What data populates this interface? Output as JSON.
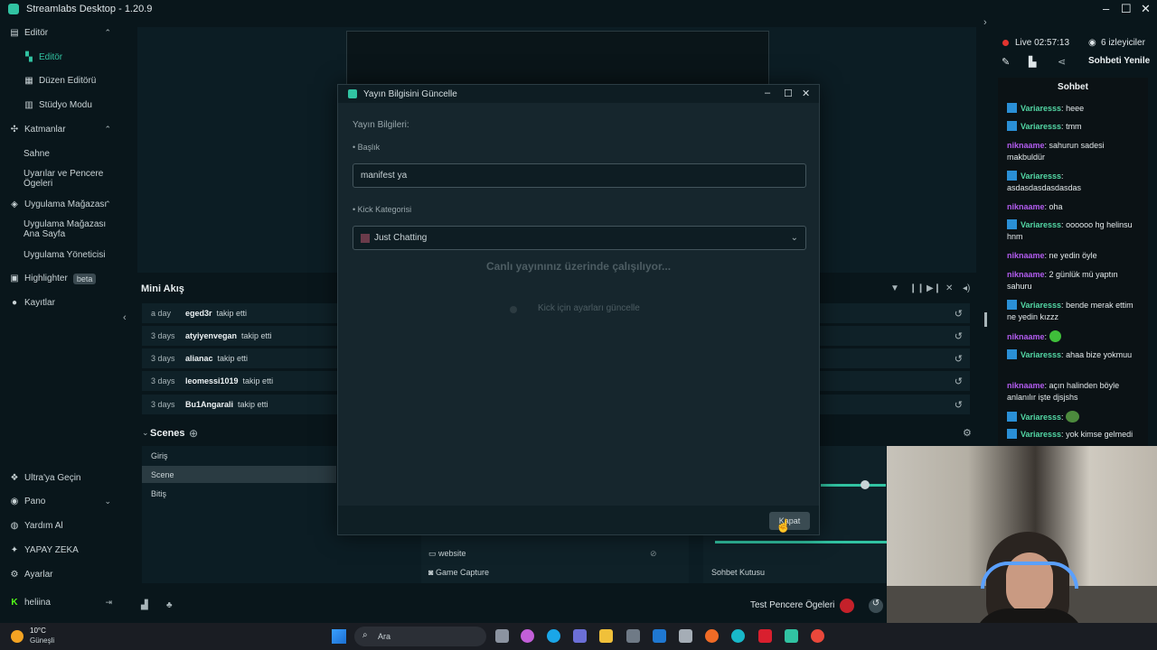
{
  "app": {
    "title": "Streamlabs Desktop - 1.20.9"
  },
  "sidebar": {
    "editor_group": "Editör",
    "editor": "Editör",
    "layout_editor": "Düzen Editörü",
    "studio_mode": "Stüdyo Modu",
    "layers_group": "Katmanlar",
    "scene": "Sahne",
    "alerts": "Uyarılar ve Pencere Ögeleri",
    "app_store_group": "Uygulama Mağazası",
    "app_store_home": "Uygulama Mağazası Ana Sayfa",
    "app_manager": "Uygulama Yöneticisi",
    "highlighter": "Highlighter",
    "beta": "beta",
    "recordings": "Kayıtlar",
    "ultra": "Ultra'ya Geçin",
    "dashboard": "Pano",
    "help": "Yardım Al",
    "ai": "YAPAY ZEKA",
    "settings": "Ayarlar",
    "user": "heliina"
  },
  "mini_feed": {
    "title": "Mini Akış",
    "rows": [
      {
        "age": "a day",
        "user": "eged3r",
        "action": "takip etti"
      },
      {
        "age": "3 days",
        "user": "atyiyenvegan",
        "action": "takip etti"
      },
      {
        "age": "3 days",
        "user": "alianac",
        "action": "takip etti"
      },
      {
        "age": "3 days",
        "user": "leomessi1019",
        "action": "takip etti"
      },
      {
        "age": "3 days",
        "user": "Bu1Angarali",
        "action": "takip etti"
      }
    ]
  },
  "scenes": {
    "title": "Scenes",
    "items": [
      "Giriş",
      "Scene",
      "Bitiş"
    ]
  },
  "sources": {
    "items": [
      "website",
      "Game Capture"
    ]
  },
  "mixer": {
    "label": "Sohbet Kutusu"
  },
  "bottom_bar": {
    "test_widgets": "Test Pencere Ögeleri"
  },
  "dialog": {
    "title": "Yayın Bilgisini Güncelle",
    "section": "Yayın Bilgileri:",
    "title_label": "Başlık",
    "title_value": "manifest ya",
    "category_label": "Kick Kategorisi",
    "category_value": "Just Chatting",
    "working": "Canlı yayınınız üzerinde çalışılıyor...",
    "step": "Kick için ayarları güncelle",
    "close": "Kapat"
  },
  "live": {
    "status": "Live 02:57:13",
    "viewers": "6 izleyiciler",
    "refresh_chat": "Sohbeti Yenile"
  },
  "chat": {
    "title": "Sohbet",
    "messages": [
      {
        "user": "Variaresss",
        "text": "heee",
        "kind": "v"
      },
      {
        "user": "Variaresss",
        "text": "tmm",
        "kind": "v"
      },
      {
        "user": "niknaame",
        "text": "sahurun sadesi makbuldür",
        "kind": "k"
      },
      {
        "user": "Variaresss",
        "text": "asdasdasdasdasdas",
        "kind": "v"
      },
      {
        "user": "niknaame",
        "text": "oha",
        "kind": "k"
      },
      {
        "user": "Variaresss",
        "text": "oooooo hg helinsu hnm",
        "kind": "v"
      },
      {
        "user": "niknaame",
        "text": "ne yedin öyle",
        "kind": "k"
      },
      {
        "user": "niknaame",
        "text": "2 günlük mü yaptın sahuru",
        "kind": "k"
      },
      {
        "user": "Variaresss",
        "text": "bende merak ettim ne yedin kızzz",
        "kind": "v"
      },
      {
        "user": "niknaame",
        "text": "",
        "kind": "k"
      },
      {
        "user": "Variaresss",
        "text": "ahaa bize yokmuu",
        "kind": "v"
      },
      {
        "user": "niknaame",
        "text": "açın halinden böyle anlanılır işte djsjshs",
        "kind": "k"
      },
      {
        "user": "Variaresss",
        "text": "",
        "kind": "v"
      },
      {
        "user": "Variaresss",
        "text": "yok kimse gelmedi",
        "kind": "v"
      }
    ]
  },
  "taskbar": {
    "weather_temp": "10°C",
    "weather_desc": "Güneşli",
    "search": "Ara"
  },
  "colors": {
    "accent": "#31c3a2",
    "kick_user": "#53d8a5",
    "viewer_user": "#b35cf0",
    "live_dot": "#e3342f"
  }
}
